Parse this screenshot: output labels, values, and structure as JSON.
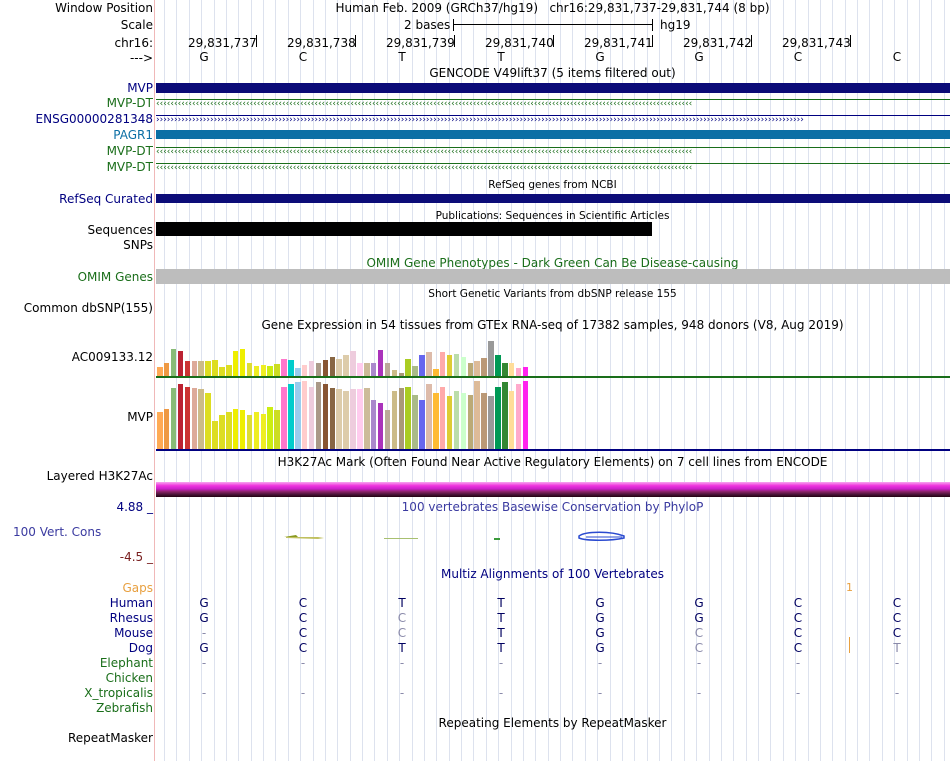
{
  "header": {
    "window_position_label": "Window Position",
    "window_position_value": "Human Feb. 2009 (GRCh37/hg19)   chr16:29,831,737-29,831,744 (8 bp)",
    "scale_label": "Scale",
    "scale_value": "2 bases",
    "scale_assembly": "hg19",
    "chrom_label": "chr16:",
    "strand_label": "--->",
    "coordinates": [
      "29,831,737",
      "29,831,738",
      "29,831,739",
      "29,831,740",
      "29,831,741",
      "29,831,742",
      "29,831,743"
    ],
    "bases": [
      "G",
      "C",
      "T",
      "T",
      "G",
      "G",
      "C",
      "C"
    ]
  },
  "gencode": {
    "title": "GENCODE V49lift37 (5 items filtered out)",
    "tracks": [
      {
        "label": "MVP",
        "color": "#000080"
      },
      {
        "label": "MVP-DT",
        "color": "#1a6e1a"
      },
      {
        "label": "ENSG00000281348",
        "color": "#000080"
      },
      {
        "label": "PAGR1",
        "color": "#0c6fa5"
      },
      {
        "label": "MVP-DT",
        "color": "#1a6e1a"
      },
      {
        "label": "MVP-DT",
        "color": "#1a6e1a"
      }
    ]
  },
  "refseq": {
    "title": "RefSeq genes from NCBI",
    "label": "RefSeq Curated"
  },
  "publications": {
    "title": "Publications: Sequences in Scientific Articles",
    "label_sequences": "Sequences",
    "label_snps": "SNPs"
  },
  "omim": {
    "title": "OMIM Gene Phenotypes - Dark Green Can Be Disease-causing",
    "label": "OMIM Genes"
  },
  "dbsnp": {
    "title": "Short Genetic Variants from dbSNP release 155",
    "label": "Common dbSNP(155)"
  },
  "gtex": {
    "title": "Gene Expression in 54 tissues from GTEx RNA-seq of 17382 samples, 948 donors (V8, Aug 2019)",
    "genes": [
      {
        "label": "AC009133.12",
        "values": [
          0.22,
          0.3,
          0.62,
          0.58,
          0.36,
          0.36,
          0.35,
          0.35,
          0.38,
          0.22,
          0.26,
          0.58,
          0.62,
          0.3,
          0.24,
          0.26,
          0.25,
          0.28,
          0.4,
          0.38,
          0.2,
          0.26,
          0.36,
          0.32,
          0.38,
          0.45,
          0.4,
          0.48,
          0.58,
          0.3,
          0.3,
          0.32,
          0.6,
          0.3,
          0.15,
          0.09,
          0.4,
          0.25,
          0.48,
          0.55,
          0.18,
          0.55,
          0.48,
          0.52,
          0.45,
          0.32,
          0.35,
          0.42,
          0.8,
          0.48,
          0.32,
          0.3,
          0.2,
          0.22
        ],
        "colors": [
          "#ffaa55",
          "#ee9944",
          "#88bb77",
          "#bb2233",
          "#cc3333",
          "#ddaa99",
          "#ccbb88",
          "#dddd22",
          "#dddd22",
          "#dddd22",
          "#dddd22",
          "#eeee00",
          "#eeee00",
          "#dddd33",
          "#eeee22",
          "#eeee22",
          "#ccee11",
          "#ccdd22",
          "#ff77cc",
          "#00cccc",
          "#99ccee",
          "#ffcccc",
          "#eeccdd",
          "#aa9988",
          "#885533",
          "#886644",
          "#ddccaa",
          "#ddccaa",
          "#eeccdd",
          "#ffccee",
          "#ccbb99",
          "#aa88cc",
          "#aa33bb",
          "#bbaa99",
          "#ccbb88",
          "#aa9977",
          "#aacc22",
          "#aabb88",
          "#6666ee",
          "#ddbbaa",
          "#ffbb33",
          "#ffaaaa",
          "#ddcc33",
          "#bbddaa",
          "#ccffcc",
          "#bbaa77",
          "#ddbb99",
          "#bb9977",
          "#999999",
          "#009955",
          "#338833",
          "#ffdd99",
          "#ffaacc",
          "#ff22ee"
        ]
      },
      {
        "label": "MVP",
        "values": [
          0.55,
          0.6,
          0.9,
          0.95,
          0.92,
          0.9,
          0.88,
          0.82,
          0.42,
          0.5,
          0.55,
          0.6,
          0.58,
          0.5,
          0.55,
          0.52,
          0.62,
          0.58,
          0.92,
          0.95,
          0.98,
          1.0,
          0.92,
          0.98,
          0.95,
          0.9,
          0.88,
          0.85,
          0.88,
          0.88,
          0.9,
          0.72,
          0.68,
          0.58,
          0.85,
          0.9,
          0.92,
          0.8,
          0.72,
          0.95,
          0.82,
          0.92,
          0.78,
          0.85,
          0.82,
          0.8,
          1.0,
          0.82,
          0.78,
          0.92,
          0.98,
          0.85,
          0.95,
          1.0
        ],
        "colors": [
          "#ffaa55",
          "#ee9944",
          "#88bb77",
          "#bb2233",
          "#cc3333",
          "#ddaa99",
          "#ccbb88",
          "#dddd22",
          "#dddd22",
          "#dddd22",
          "#dddd22",
          "#eeee00",
          "#eeee00",
          "#dddd33",
          "#eeee22",
          "#eeee22",
          "#ccee11",
          "#ccdd22",
          "#ff77cc",
          "#00cccc",
          "#99ccee",
          "#ffcccc",
          "#eeccdd",
          "#aa9988",
          "#885533",
          "#886644",
          "#ddccaa",
          "#ddccaa",
          "#eeccdd",
          "#ffccee",
          "#ccbb99",
          "#aa88cc",
          "#aa33bb",
          "#bbaa99",
          "#ccbb88",
          "#aa9977",
          "#aacc22",
          "#aabb88",
          "#6666ee",
          "#ddbbaa",
          "#ffbb33",
          "#ffaaaa",
          "#ddcc33",
          "#bbddaa",
          "#ccffcc",
          "#bbaa77",
          "#ddbb99",
          "#bb9977",
          "#999999",
          "#009955",
          "#338833",
          "#ffdd99",
          "#ffaacc",
          "#ff22ee"
        ]
      }
    ]
  },
  "h3k27ac": {
    "title": "H3K27Ac Mark (Often Found Near Active Regulatory Elements) on 7 cell lines from ENCODE",
    "label": "Layered H3K27Ac"
  },
  "phylop": {
    "title": "100 vertebrates Basewise Conservation by PhyloP",
    "label": "100 Vert. Cons",
    "max": "4.88 _",
    "min": "-4.5 _"
  },
  "multiz": {
    "title": "Multiz Alignments of 100 Vertebrates",
    "gaps_label": "Gaps",
    "gaps_mark": "1",
    "species": [
      {
        "name": "Human",
        "bases": [
          "G",
          "C",
          "T",
          "T",
          "G",
          "G",
          "C",
          "C"
        ],
        "dim": [
          0,
          0,
          0,
          0,
          0,
          0,
          0,
          0
        ]
      },
      {
        "name": "Rhesus",
        "bases": [
          "G",
          "C",
          "C",
          "T",
          "G",
          "G",
          "C",
          "C"
        ],
        "dim": [
          0,
          0,
          1,
          0,
          0,
          0,
          0,
          0
        ]
      },
      {
        "name": "Mouse",
        "bases": [
          "-",
          "C",
          "C",
          "T",
          "G",
          "C",
          "C",
          "C"
        ],
        "dim": [
          1,
          0,
          1,
          0,
          0,
          1,
          0,
          0
        ]
      },
      {
        "name": "Dog",
        "bases": [
          "G",
          "C",
          "T",
          "T",
          "G",
          "C",
          "C",
          "T"
        ],
        "dim": [
          0,
          0,
          0,
          0,
          0,
          1,
          0,
          1
        ]
      },
      {
        "name": "Elephant",
        "bases": [
          "-",
          "-",
          "-",
          "-",
          "-",
          "-",
          "-",
          "-"
        ],
        "dim": [
          1,
          1,
          1,
          1,
          1,
          1,
          1,
          1
        ]
      },
      {
        "name": "Chicken",
        "bases": [
          "",
          "",
          "",
          "",
          "",
          "",
          "",
          ""
        ],
        "dim": [
          0,
          0,
          0,
          0,
          0,
          0,
          0,
          0
        ]
      },
      {
        "name": "X_tropicalis",
        "bases": [
          "-",
          "-",
          "-",
          "-",
          "-",
          "-",
          "-",
          "-"
        ],
        "dim": [
          1,
          1,
          1,
          1,
          1,
          1,
          1,
          1
        ]
      },
      {
        "name": "Zebrafish",
        "bases": [
          "",
          "",
          "",
          "",
          "",
          "",
          "",
          ""
        ],
        "dim": [
          0,
          0,
          0,
          0,
          0,
          0,
          0,
          0
        ]
      }
    ],
    "species_colors": {
      "mammal": "#000080",
      "other": "#1a6e1a"
    }
  },
  "repeatmasker": {
    "title": "Repeating Elements by RepeatMasker",
    "label": "RepeatMasker"
  }
}
